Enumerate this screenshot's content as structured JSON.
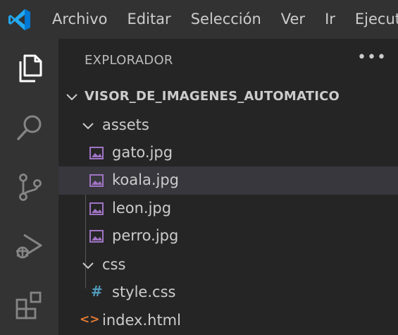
{
  "menu": {
    "items": [
      "Archivo",
      "Editar",
      "Selección",
      "Ver",
      "Ir",
      "Ejecutar"
    ]
  },
  "activity_bar": {
    "items": [
      "files-icon",
      "search-icon",
      "source-control-icon",
      "run-debug-icon",
      "extensions-icon"
    ]
  },
  "explorer": {
    "title": "EXPLORADOR",
    "more_label": "•••",
    "root": "VISOR_DE_IMAGENES_AUTOMATICO",
    "folders": {
      "assets": "assets",
      "css": "css"
    },
    "files": {
      "gato": "gato.jpg",
      "koala": "koala.jpg",
      "leon": "leon.jpg",
      "perro": "perro.jpg",
      "style": "style.css",
      "index": "index.html"
    },
    "icons": {
      "hash": "#",
      "html": "<>"
    }
  },
  "colors": {
    "accent": "#0078d4",
    "image_icon": "#a074c4",
    "css_icon": "#519aba",
    "html_icon": "#e37933"
  }
}
